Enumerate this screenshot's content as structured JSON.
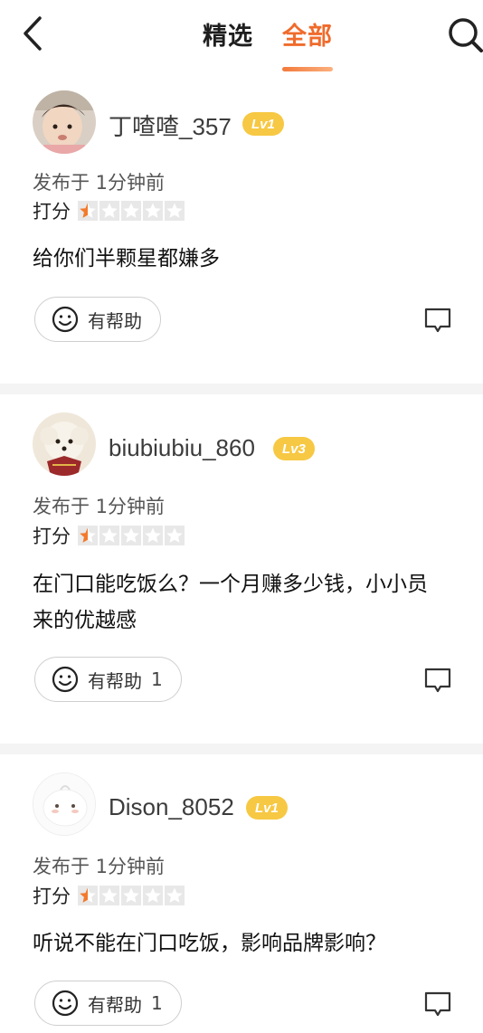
{
  "header": {
    "back_icon": "chevron-left-icon",
    "tabs": [
      {
        "label": "精选",
        "active": false
      },
      {
        "label": "全部",
        "active": true
      }
    ],
    "search_icon": "search-icon",
    "accent_color": "#f06b2c"
  },
  "reviews": [
    {
      "username": "丁喳喳_357",
      "level": "Lv1",
      "posted": "发布于 1分钟前",
      "score_label": "打分",
      "rating": 0.5,
      "rating_max": 5,
      "content_lines": [
        "给你们半颗星都嫌多"
      ],
      "help_label": "有帮助",
      "help_count": ""
    },
    {
      "username": "biubiubiu_860",
      "level": "Lv3",
      "posted": "发布于 1分钟前",
      "score_label": "打分",
      "rating": 0.5,
      "rating_max": 5,
      "content_lines": [
        "在门口能吃饭么？一个月赚多少钱，小小员",
        "来的优越感"
      ],
      "help_label": "有帮助",
      "help_count": "1"
    },
    {
      "username": "Dison_8052",
      "level": "Lv1",
      "posted": "发布于 1分钟前",
      "score_label": "打分",
      "rating": 0.5,
      "rating_max": 5,
      "content_lines": [
        "听说不能在门口吃饭，影响品牌影响？"
      ],
      "help_label": "有帮助",
      "help_count": "1"
    }
  ]
}
